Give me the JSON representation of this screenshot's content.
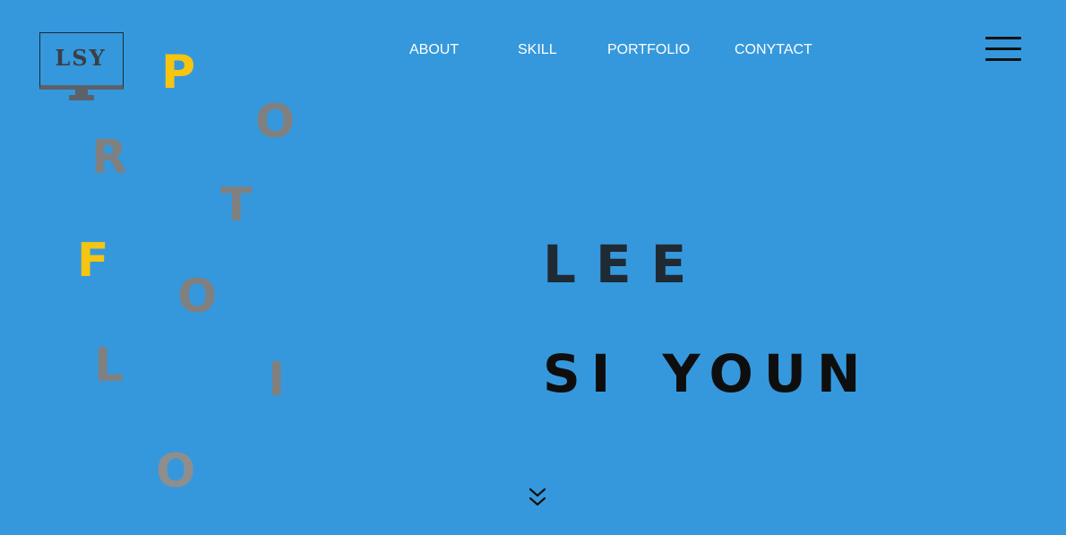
{
  "logo": {
    "text": "LSY"
  },
  "nav": {
    "items": [
      {
        "label": "ABOUT"
      },
      {
        "label": "SKILL"
      },
      {
        "label": "PORTFOLIO"
      },
      {
        "label": "CONYTACT"
      }
    ]
  },
  "menu": {
    "icon": "hamburger-menu-icon"
  },
  "decor": {
    "letters": [
      "P",
      "O",
      "R",
      "T",
      "F",
      "O",
      "L",
      "I",
      "O"
    ],
    "accent_color": "#f5c511",
    "muted_color": "#808080"
  },
  "hero": {
    "first_name": "LEE",
    "last_name": "SI YOUN"
  },
  "scroll": {
    "icon": "double-chevron-down-icon"
  },
  "colors": {
    "background": "#3598dc",
    "text_light": "#ffffff",
    "text_dark": "#0e0e0e"
  }
}
